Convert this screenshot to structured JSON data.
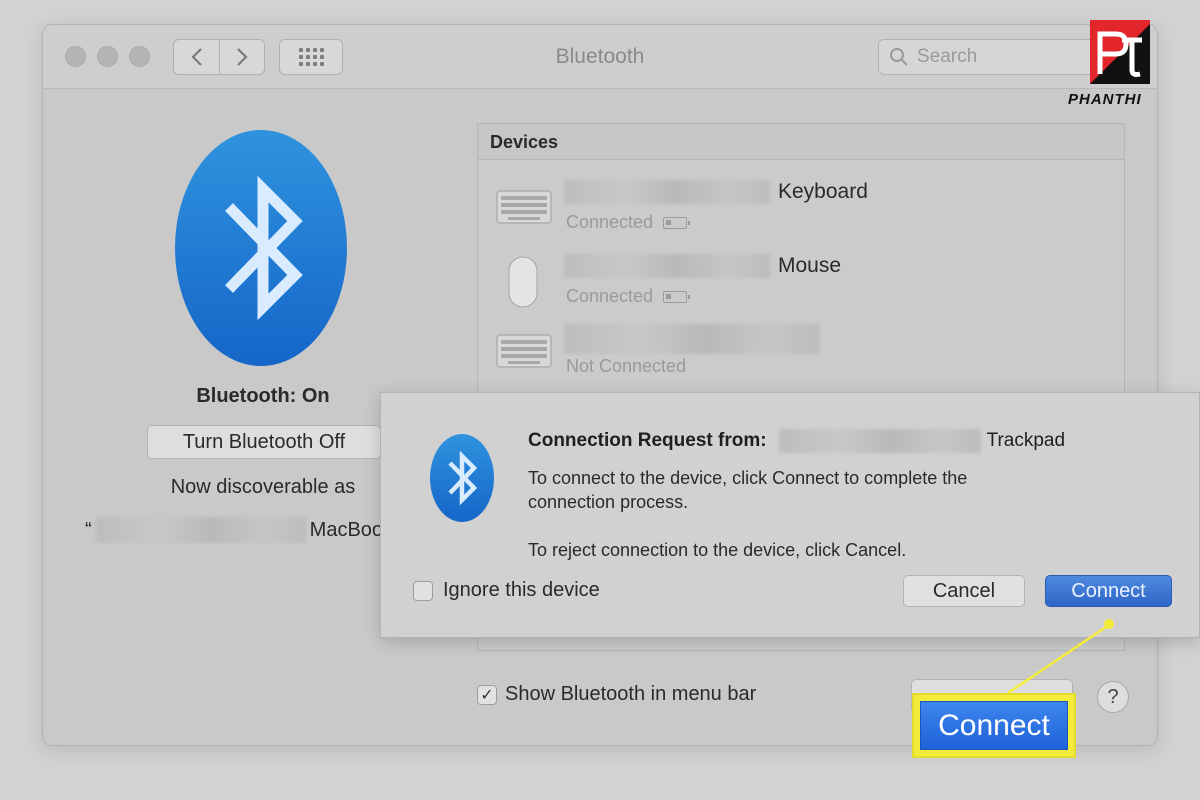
{
  "window": {
    "title": "Bluetooth",
    "search_placeholder": "Search"
  },
  "sidebar": {
    "status": "Bluetooth: On",
    "turn_off_label": "Turn Bluetooth Off",
    "discoverable_text": "Now discoverable as",
    "computer_prefix": "“",
    "computer_suffix": "MacBoo"
  },
  "devices": {
    "header": "Devices",
    "items": [
      {
        "name": "Keyboard",
        "status": "Connected",
        "icon": "keyboard-icon"
      },
      {
        "name": "Mouse",
        "status": "Connected",
        "icon": "mouse-icon"
      },
      {
        "name": "",
        "status": "Not Connected",
        "icon": "keyboard-icon"
      }
    ]
  },
  "options": {
    "show_in_menu_bar": "Show Bluetooth in menu bar",
    "help": "?"
  },
  "dialog": {
    "title_prefix": "Connection Request from:",
    "device_suffix": "Trackpad",
    "line1": "To connect to the device, click Connect to complete the",
    "line2": "connection process.",
    "line3": "To reject connection to the device, click Cancel.",
    "ignore_label": "Ignore this device",
    "cancel_label": "Cancel",
    "connect_label": "Connect"
  },
  "callout": {
    "label": "Connect",
    "color": "#f4ec3a"
  },
  "brand": {
    "name": "PHANTHI",
    "accent": "#e3262b"
  }
}
